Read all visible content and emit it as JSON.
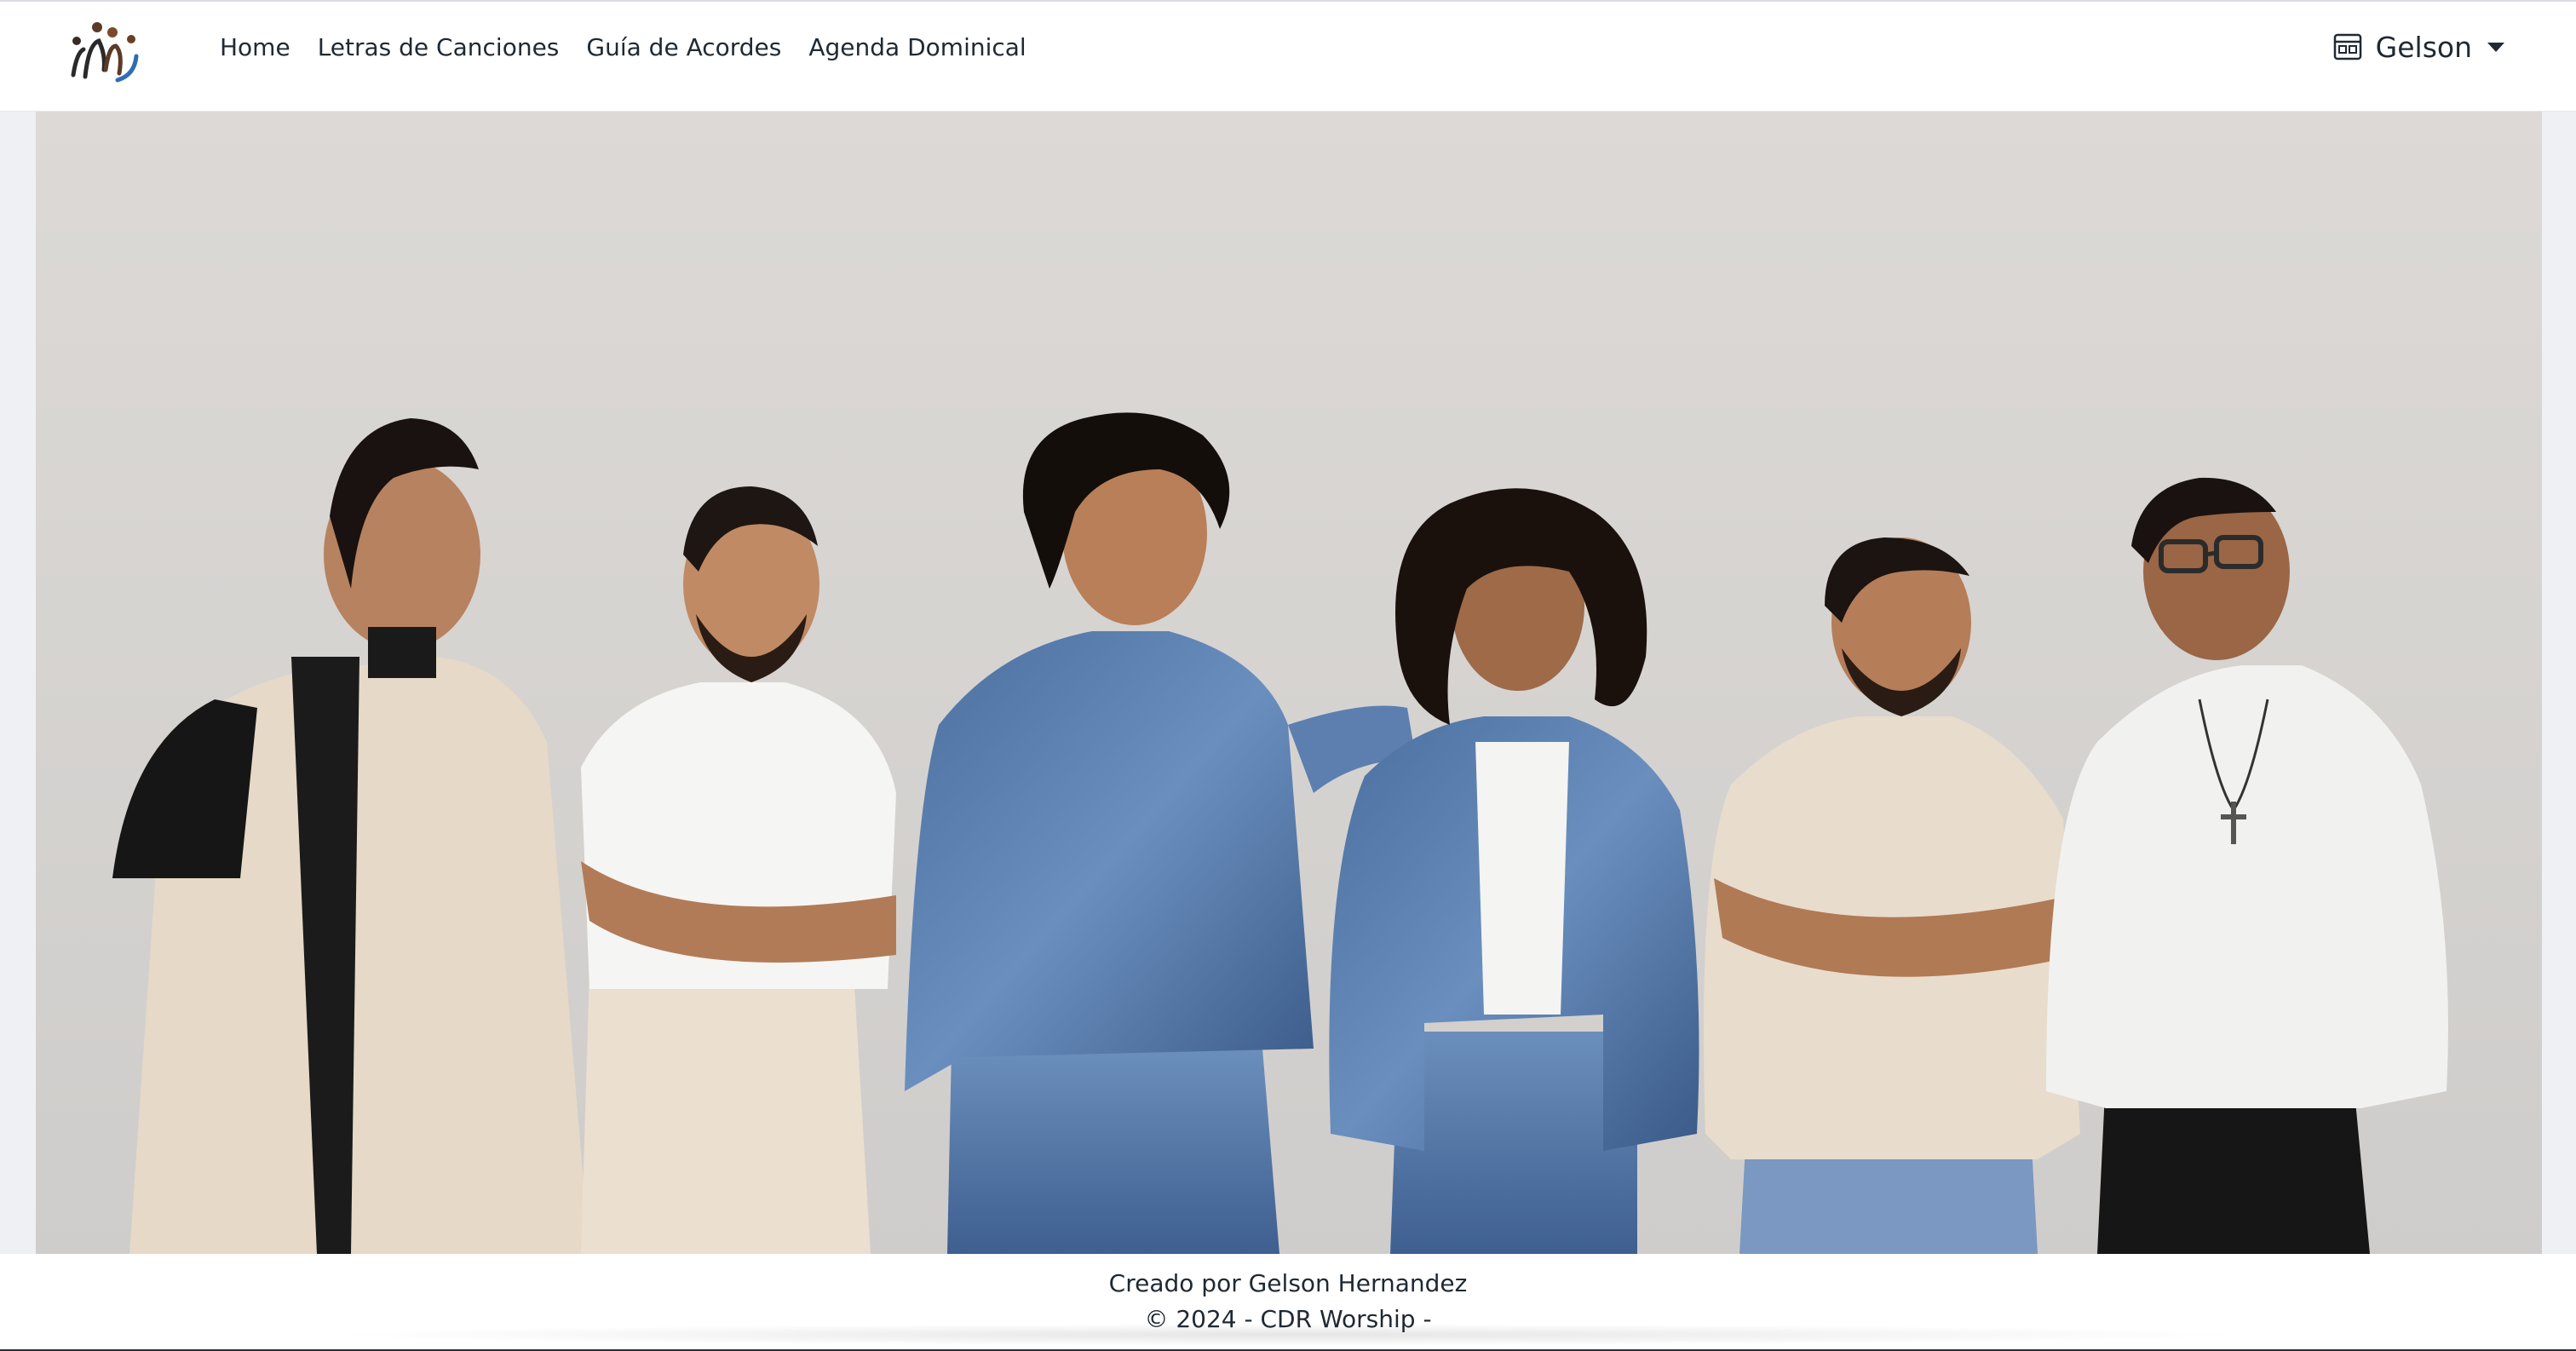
{
  "navbar": {
    "brand_icon": "worship-team-logo-icon",
    "links": [
      {
        "label": "Home"
      },
      {
        "label": "Letras de Canciones"
      },
      {
        "label": "Guía de Acordes"
      },
      {
        "label": "Agenda Dominical"
      }
    ],
    "user": {
      "name": "Gelson",
      "icon": "calendar-badge-icon"
    }
  },
  "hero": {
    "image": "team-photo"
  },
  "footer": {
    "credit": "Creado por Gelson Hernandez",
    "copyright": "© 2024 - CDR Worship -"
  },
  "colors": {
    "page_bg": "#eef0f3",
    "navbar_bg": "#ffffff",
    "text": "#1f2933",
    "logo_dark": "#2a2a2a",
    "logo_accent": "#7a4a2a",
    "logo_blue": "#2f6db3"
  }
}
